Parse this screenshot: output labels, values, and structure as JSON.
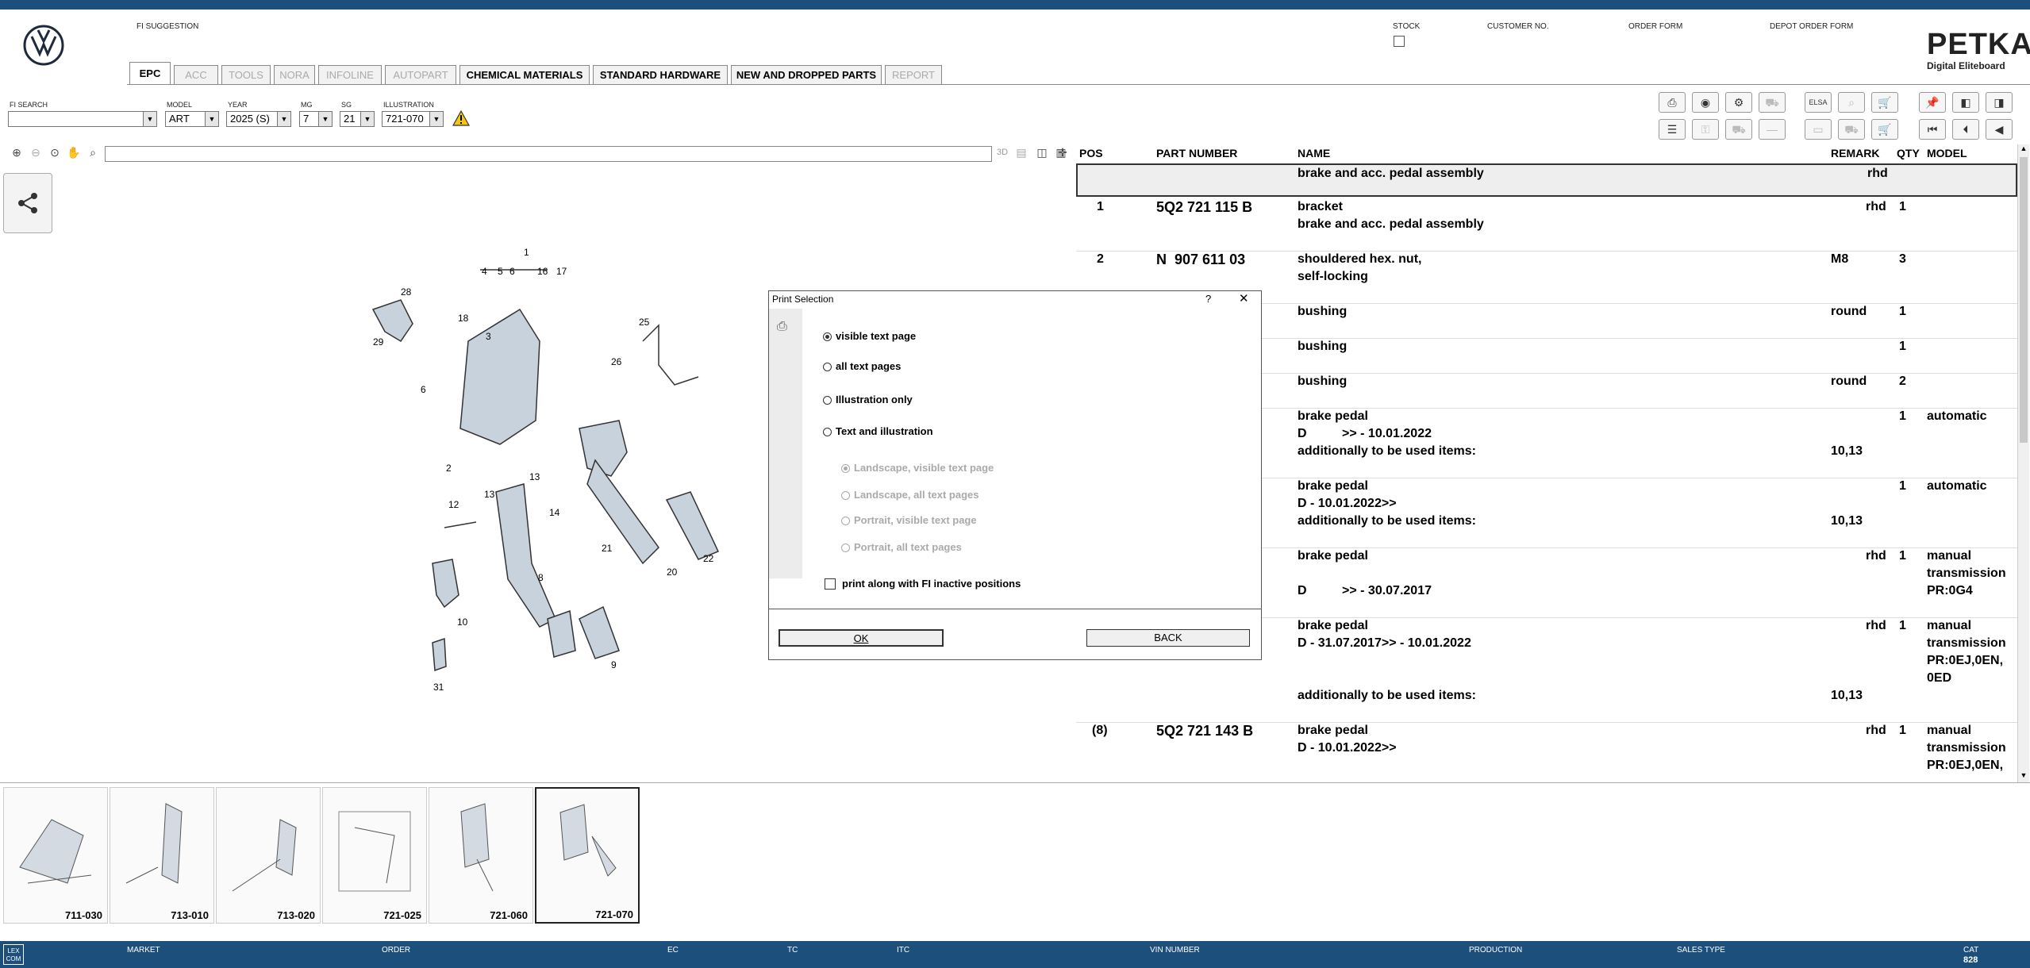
{
  "app": {
    "fi_suggestion_label": "FI SUGGESTION",
    "stock_label": "STOCK",
    "customer_no_label": "CUSTOMER NO.",
    "order_form_label": "ORDER FORM",
    "depot_order_form_label": "DEPOT ORDER FORM",
    "brand_title": "PETKA",
    "brand_subtitle": "Digital Eliteboard",
    "accent_color": "#1d4f7c"
  },
  "tabs": [
    {
      "label": "EPC"
    },
    {
      "label": "ACC"
    },
    {
      "label": "TOOLS"
    },
    {
      "label": "NORA"
    },
    {
      "label": "INFOLINE"
    },
    {
      "label": "AUTOPART"
    },
    {
      "label": "CHEMICAL MATERIALS"
    },
    {
      "label": "STANDARD HARDWARE"
    },
    {
      "label": "NEW AND DROPPED PARTS"
    },
    {
      "label": "REPORT"
    }
  ],
  "filters": {
    "fi_search": {
      "label": "FI SEARCH",
      "value": ""
    },
    "model": {
      "label": "MODEL",
      "value": "ART"
    },
    "year": {
      "label": "YEAR",
      "value": "2025 (S)"
    },
    "mg": {
      "label": "MG",
      "value": "7"
    },
    "sg": {
      "label": "SG",
      "value": "21"
    },
    "illustration": {
      "label": "ILLUSTRATION",
      "value": "721-070"
    }
  },
  "viewer_toolbar": {
    "btn_3d": "3D"
  },
  "table": {
    "headers": {
      "pos": "POS",
      "part_number": "PART NUMBER",
      "name": "NAME",
      "remark": "REMARK",
      "qty": "QTY",
      "model": "MODEL"
    },
    "rows": [
      {
        "pos": "",
        "part": "",
        "name1": "brake and acc. pedal assembly",
        "name2": "",
        "name3": "",
        "remark": "rhd",
        "remark2": "",
        "qty": "",
        "model1": "",
        "model2": "",
        "model3": "",
        "model4": ""
      },
      {
        "pos": "1",
        "part": "5Q2 721 115 B",
        "name1": "bracket",
        "name2": "brake and acc. pedal assembly",
        "name3": "",
        "remark": "rhd",
        "remark2": "",
        "qty": "1",
        "model1": "",
        "model2": "",
        "model3": "",
        "model4": ""
      },
      {
        "pos": "2",
        "part": "N  907 611 03",
        "name1": "shouldered hex. nut,",
        "name2": "self-locking",
        "name3": "",
        "remark": "M8",
        "remark2": "",
        "qty": "3",
        "model1": "",
        "model2": "",
        "model3": "",
        "model4": ""
      },
      {
        "pos": "",
        "part": "",
        "name1": "bushing",
        "name2": "",
        "name3": "",
        "remark": "round",
        "remark2": "",
        "qty": "1",
        "model1": "",
        "model2": "",
        "model3": "",
        "model4": ""
      },
      {
        "pos": "",
        "part": "",
        "name1": "bushing",
        "name2": "",
        "name3": "",
        "remark": "",
        "remark2": "",
        "qty": "1",
        "model1": "",
        "model2": "",
        "model3": "",
        "model4": ""
      },
      {
        "pos": "",
        "part": "",
        "name1": "bushing",
        "name2": "",
        "name3": "",
        "remark": "round",
        "remark2": "",
        "qty": "2",
        "model1": "",
        "model2": "",
        "model3": "",
        "model4": ""
      },
      {
        "pos": "",
        "part": "",
        "name1": "brake pedal",
        "name2": "D          >> - 10.01.2022",
        "name3": "additionally to be used items:",
        "remark": "",
        "remark2": "10,13",
        "qty": "1",
        "model1": "automatic",
        "model2": "",
        "model3": "",
        "model4": ""
      },
      {
        "pos": "",
        "part": "",
        "name1": "brake pedal",
        "name2": "D - 10.01.2022>>",
        "name3": "additionally to be used items:",
        "remark": "",
        "remark2": "10,13",
        "qty": "1",
        "model1": "automatic",
        "model2": "",
        "model3": "",
        "model4": ""
      },
      {
        "pos": "",
        "part": "",
        "name1": "brake pedal",
        "name2": "",
        "name3": "D          >> - 30.07.2017",
        "remark": "rhd",
        "remark2": "",
        "qty": "1",
        "model1": "manual",
        "model2": "transmission",
        "model3": "PR:0G4",
        "model4": ""
      },
      {
        "pos": "",
        "part": "",
        "name1": "brake pedal",
        "name2": "D - 31.07.2017>> - 10.01.2022",
        "name3": "",
        "name4": "additionally to be used items:",
        "remark": "rhd",
        "remark2": "10,13",
        "qty": "1",
        "model1": "manual",
        "model2": "transmission",
        "model3": "PR:0EJ,0EN,",
        "model4": "0ED"
      },
      {
        "pos": "(8)",
        "part": "5Q2 721 143 B",
        "name1": "brake pedal",
        "name2": "D - 10.01.2022>>",
        "name3": "",
        "remark": "rhd",
        "remark2": "",
        "qty": "1",
        "model1": "manual",
        "model2": "transmission",
        "model3": "PR:0EJ,0EN,",
        "model4": "0ED"
      }
    ]
  },
  "diagram_labels": [
    "1",
    "4",
    "5",
    "6",
    "16",
    "17",
    "28",
    "18",
    "29",
    "3",
    "6",
    "2",
    "25",
    "26",
    "13",
    "12",
    "13",
    "14",
    "21",
    "20",
    "22",
    "8",
    "10",
    "9",
    "31"
  ],
  "thumbnails": [
    {
      "label": "711-030"
    },
    {
      "label": "713-010"
    },
    {
      "label": "713-020"
    },
    {
      "label": "721-025"
    },
    {
      "label": "721-060"
    },
    {
      "label": "721-070"
    }
  ],
  "status": {
    "market": "MARKET",
    "order": "ORDER",
    "ec": "EC",
    "tc": "TC",
    "itc": "ITC",
    "vin": "VIN NUMBER",
    "production": "PRODUCTION",
    "sales_type": "SALES TYPE",
    "cat": "CAT",
    "cat_value": "828",
    "logo": "LEX COM"
  },
  "dialog": {
    "title": "Print Selection",
    "help": "?",
    "close": "✕",
    "options": [
      {
        "label": "visible text page",
        "selected": true
      },
      {
        "label": "all text pages",
        "selected": false
      },
      {
        "label": "Illustration only",
        "selected": false
      },
      {
        "label": "Text and illustration",
        "selected": false
      }
    ],
    "sub_options": [
      {
        "label": "Landscape, visible text page",
        "selected": true
      },
      {
        "label": "Landscape, all text pages",
        "selected": false
      },
      {
        "label": "Portrait, visible text page",
        "selected": false
      },
      {
        "label": "Portrait, all text pages",
        "selected": false
      }
    ],
    "checkbox_label": "print along with FI inactive positions",
    "ok": "OK",
    "back": "BACK"
  }
}
